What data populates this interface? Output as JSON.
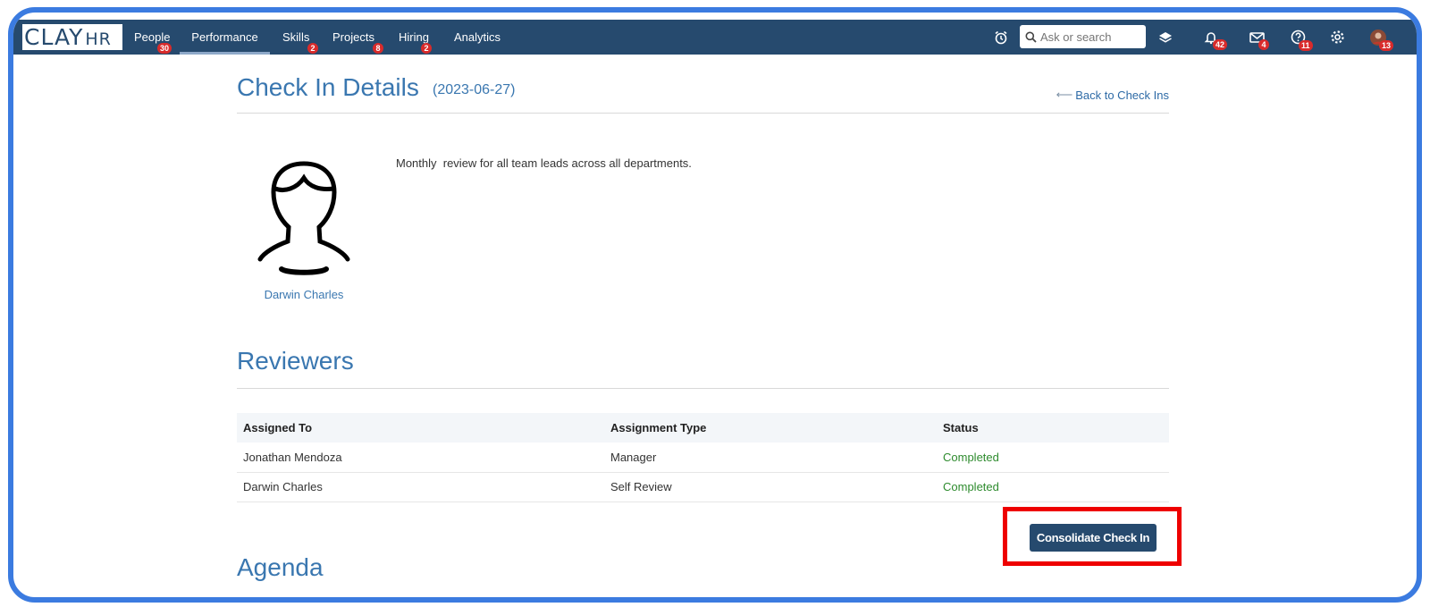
{
  "app": {
    "logo_main": "CLAY",
    "logo_sub": "HR"
  },
  "nav": {
    "items": [
      {
        "label": "People",
        "badge": "30"
      },
      {
        "label": "Performance",
        "badge": "",
        "active": true
      },
      {
        "label": "Skills",
        "badge": "2"
      },
      {
        "label": "Projects",
        "badge": "8"
      },
      {
        "label": "Hiring",
        "badge": "2"
      },
      {
        "label": "Analytics",
        "badge": ""
      }
    ],
    "search_placeholder": "Ask or search",
    "icons": [
      {
        "name": "alarm-clock-icon",
        "badge": ""
      },
      {
        "name": "layers-icon",
        "badge": ""
      },
      {
        "name": "bell-icon",
        "badge": "42"
      },
      {
        "name": "mail-icon",
        "badge": "4"
      },
      {
        "name": "help-icon",
        "badge": "11"
      },
      {
        "name": "gear-icon",
        "badge": ""
      },
      {
        "name": "user-avatar-icon",
        "badge": "13"
      }
    ]
  },
  "page": {
    "title": "Check In Details",
    "date": "(2023-06-27)",
    "back_link": "Back to Check Ins"
  },
  "profile": {
    "name": "Darwin Charles",
    "description": "Monthly  review for all team leads across all departments."
  },
  "reviewers": {
    "title": "Reviewers",
    "columns": [
      "Assigned To",
      "Assignment Type",
      "Status"
    ],
    "rows": [
      [
        "Jonathan Mendoza",
        "Manager",
        "Completed"
      ],
      [
        "Darwin Charles",
        "Self Review",
        "Completed"
      ]
    ],
    "status_color": "#2e8b2e"
  },
  "actions": {
    "consolidate_label": "Consolidate Check In"
  },
  "agenda": {
    "title": "Agenda"
  },
  "colors": {
    "nav_bg": "#264a6e",
    "accent": "#3a77b0",
    "badge": "#d92b2b",
    "highlight": "#ee0000"
  }
}
